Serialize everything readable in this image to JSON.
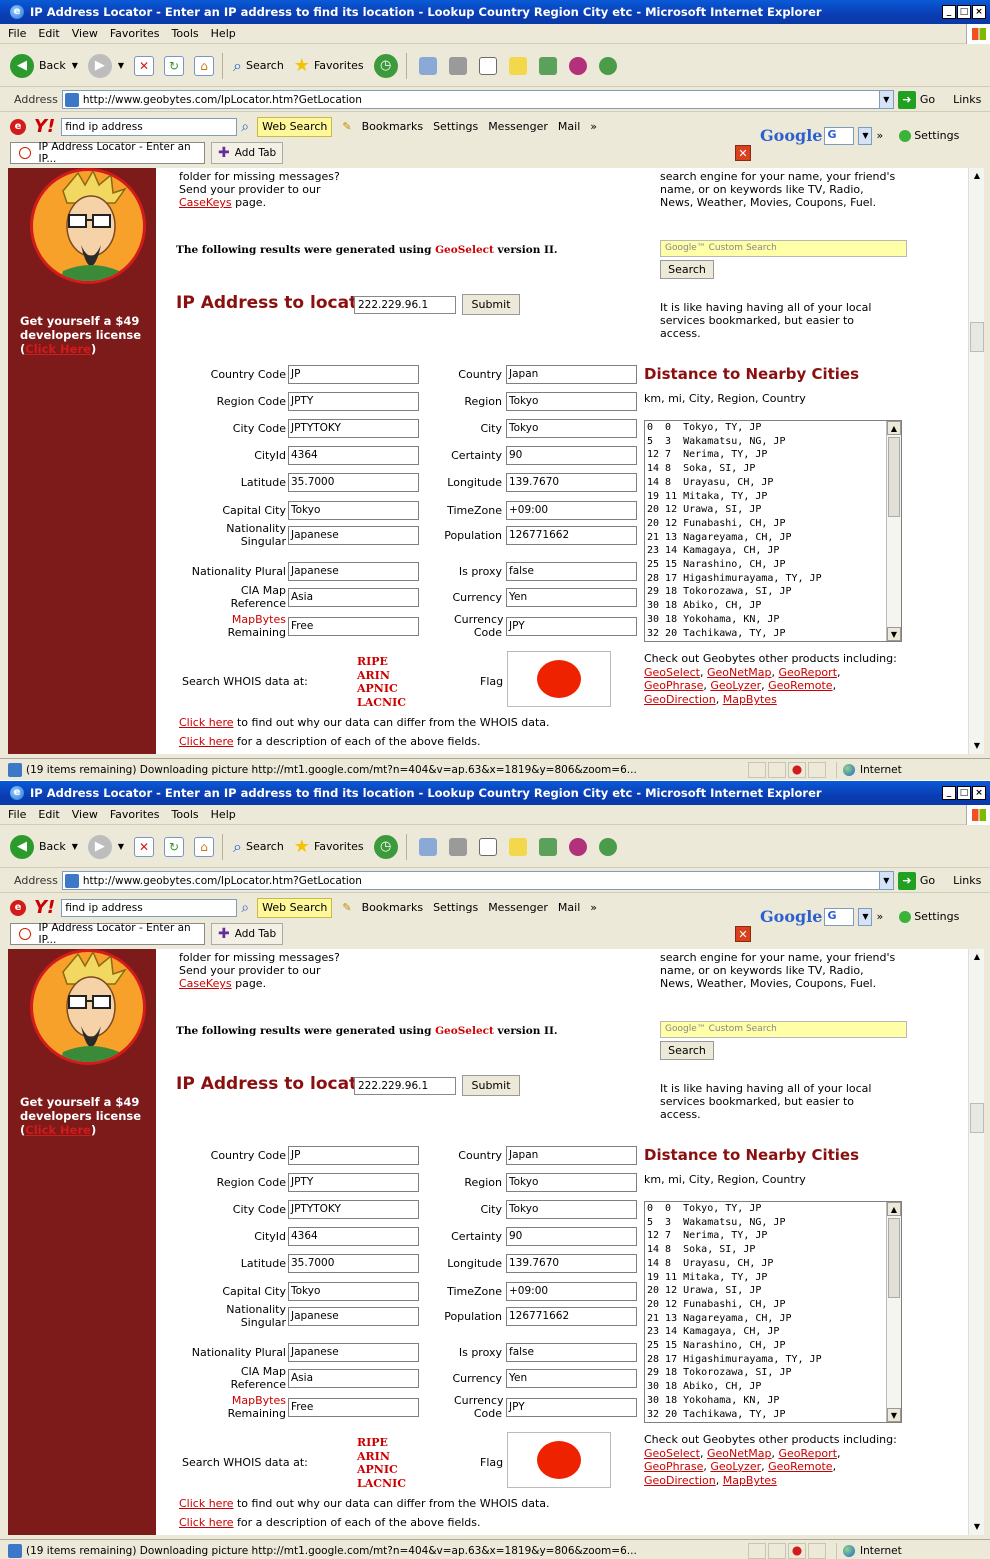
{
  "window": {
    "title": "IP Address Locator - Enter an IP address to find its location - Lookup Country Region City etc - Microsoft Internet Explorer"
  },
  "menu": [
    "File",
    "Edit",
    "View",
    "Favorites",
    "Tools",
    "Help"
  ],
  "toolbar": {
    "back": "Back",
    "search": "Search",
    "favorites": "Favorites"
  },
  "address": {
    "label": "Address",
    "url": "http://www.geobytes.com/IpLocator.htm?GetLocation",
    "go": "Go",
    "links": "Links"
  },
  "yahoo": {
    "search_value": "find ip address",
    "web_search": "Web Search",
    "bookmarks": "Bookmarks",
    "settings": "Settings",
    "messenger": "Messenger",
    "mail": "Mail",
    "overflow": "»"
  },
  "google": {
    "logo": "Google",
    "selector": "G",
    "settings": "Settings",
    "overflow": "»"
  },
  "tabs": {
    "active": "IP Address Locator - Enter an IP...",
    "add": "Add Tab"
  },
  "sidebar": {
    "promo": "Get yourself a $49 developers license",
    "promo_link": "Click Here"
  },
  "page": {
    "intro_left": {
      "prefix": "folder for missing messages? Send your provider to our ",
      "link": "CaseKeys",
      "suffix": " page."
    },
    "intro_right": "search engine for your name, your friend's name, or on keywords like TV, Radio, News, Weather, Movies, Coupons, Fuel.",
    "results_note": {
      "prefix": "The following results were generated using ",
      "link": "GeoSelect",
      "suffix": " version II."
    },
    "google_custom_search": "Google™ Custom Search",
    "search_button": "Search",
    "ip_label": "IP Address to locate:",
    "ip_value": "222.229.96.1",
    "submit": "Submit",
    "local_services": "It is like having having all of your local services bookmarked, but easier to access.",
    "fields_left": [
      {
        "label": "Country Code",
        "value": "JP"
      },
      {
        "label": "Region Code",
        "value": "JPTY"
      },
      {
        "label": "City Code",
        "value": "JPTYTOKY"
      },
      {
        "label": "CityId",
        "value": "4364"
      },
      {
        "label": "Latitude",
        "value": "35.7000"
      },
      {
        "label": "Capital City",
        "value": "Tokyo"
      },
      {
        "label": "Nationality Singular",
        "value": "Japanese"
      },
      {
        "label": "Nationality Plural",
        "value": "Japanese"
      },
      {
        "label": "CIA Map Reference",
        "value": "Asia"
      },
      {
        "label_link": "MapBytes",
        "label_rest": "Remaining",
        "value": "Free"
      }
    ],
    "fields_mid": [
      {
        "label": "Country",
        "value": "Japan"
      },
      {
        "label": "Region",
        "value": "Tokyo"
      },
      {
        "label": "City",
        "value": "Tokyo"
      },
      {
        "label": "Certainty",
        "value": "90"
      },
      {
        "label": "Longitude",
        "value": "139.7670"
      },
      {
        "label": "TimeZone",
        "value": "+09:00"
      },
      {
        "label": "Population",
        "value": "126771662"
      },
      {
        "label": "Is proxy",
        "value": "false"
      },
      {
        "label": "Currency",
        "value": "Yen"
      },
      {
        "label": "Currency Code",
        "value": "JPY"
      }
    ],
    "distance_heading": "Distance to Nearby Cities",
    "distance_columns": "km, mi, City, Region, Country",
    "cities": [
      "0  0  Tokyo, TY, JP",
      "5  3  Wakamatsu, NG, JP",
      "12 7  Nerima, TY, JP",
      "14 8  Soka, SI, JP",
      "14 8  Urayasu, CH, JP",
      "19 11 Mitaka, TY, JP",
      "20 12 Urawa, SI, JP",
      "20 12 Funabashi, CH, JP",
      "21 13 Nagareyama, CH, JP",
      "23 14 Kamagaya, CH, JP",
      "25 15 Narashino, CH, JP",
      "28 17 Higashimurayama, TY, JP",
      "29 18 Tokorozawa, SI, JP",
      "30 18 Abiko, CH, JP",
      "30 18 Yokohama, KN, JP",
      "32 20 Tachikawa, TY, JP"
    ],
    "whois_label": "Search WHOIS data at:",
    "whois_links": [
      "RIPE",
      "ARIN",
      "APNIC",
      "LACNIC"
    ],
    "flag_label": "Flag",
    "products_intro": "Check out Geobytes other products including:",
    "products": [
      "GeoSelect",
      "GeoNetMap",
      "GeoReport",
      "GeoPhrase",
      "GeoLyzer",
      "GeoRemote",
      "GeoDirection",
      "MapBytes"
    ],
    "click_here": "Click here",
    "line1_rest": " to find out why our data can differ from the WHOIS data.",
    "line2_rest": " for a description of each of the above fields."
  },
  "status": {
    "text": "(19 items remaining) Downloading picture http://mt1.google.com/mt?n=404&v=ap.63&x=1819&y=806&zoom=6...",
    "zone": "Internet"
  },
  "colors": {
    "title_blue": "#0a3db3",
    "sidebar_red": "#7d1a1a",
    "link_red": "#cc0000",
    "flag_red": "#ef2200"
  }
}
